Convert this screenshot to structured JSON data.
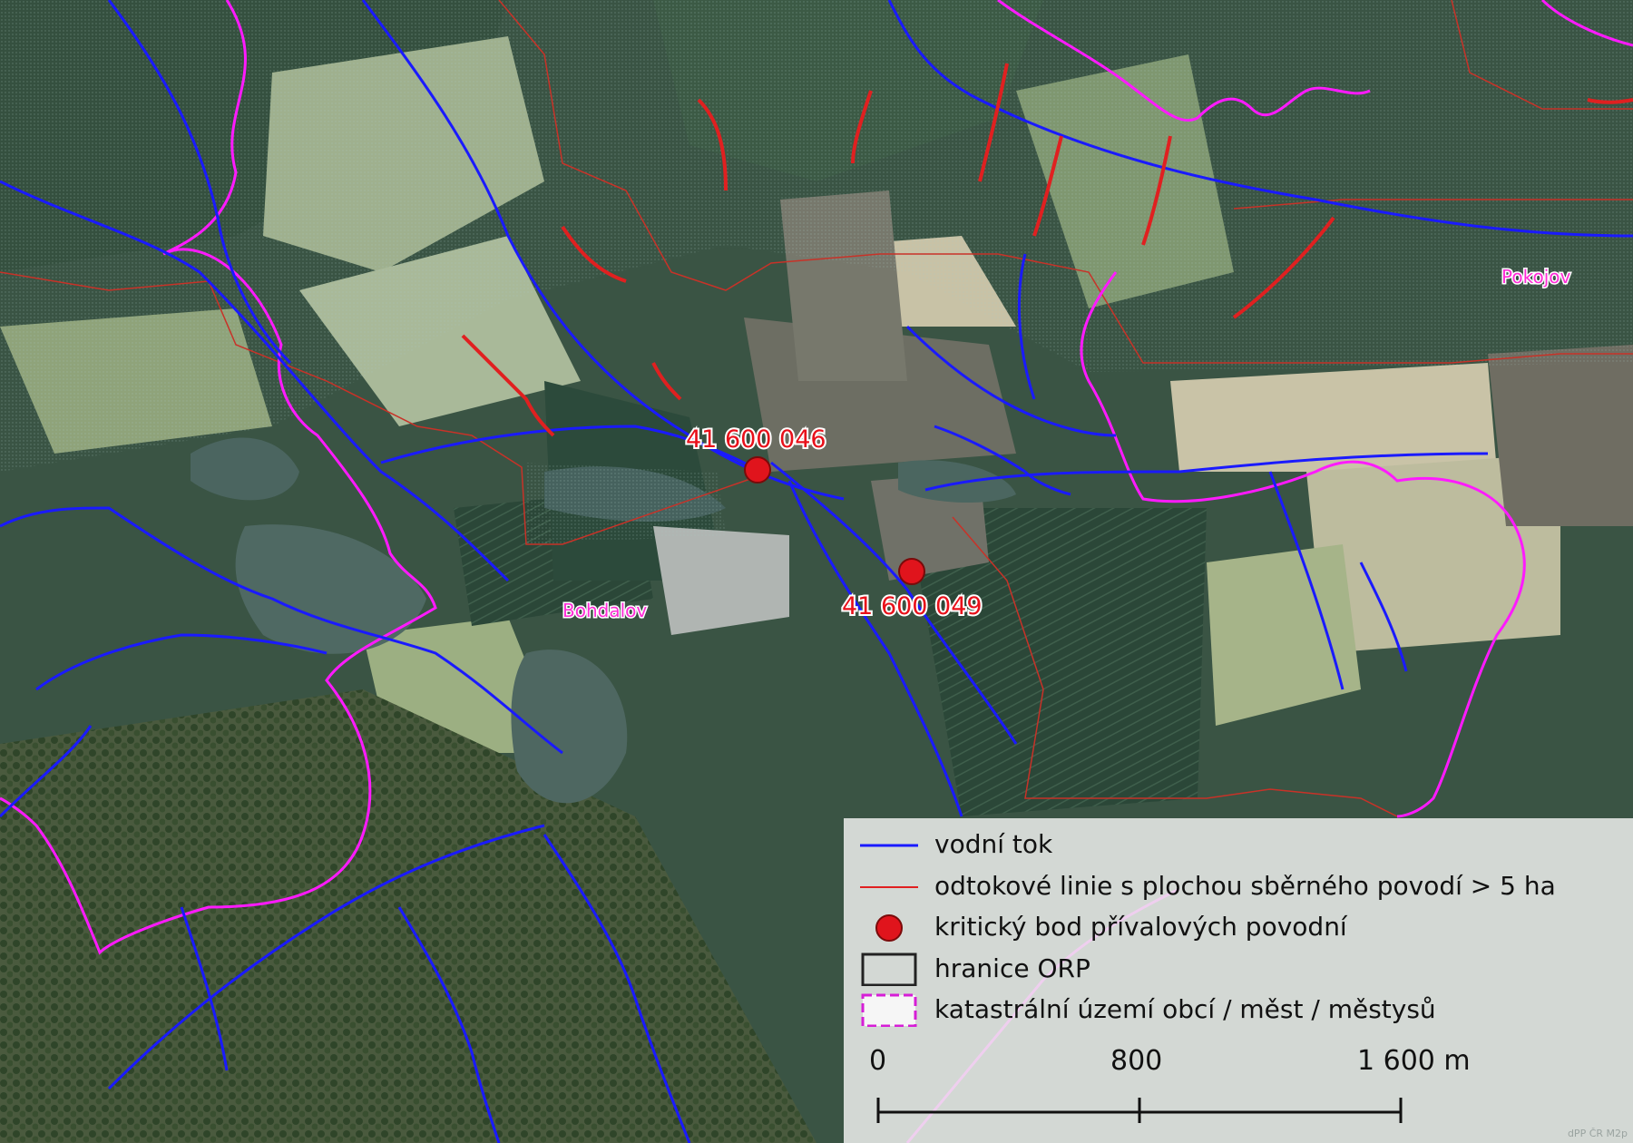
{
  "places": {
    "bohdalov": "Bohdalov",
    "pokojov": "Pokojov"
  },
  "critical_points": [
    {
      "id": "41 600 046"
    },
    {
      "id": "41 600 049"
    }
  ],
  "legend": {
    "items": [
      {
        "label": "vodní tok",
        "symbol": "line",
        "color": "#1a1aff"
      },
      {
        "label": "odtokové linie s plochou sběrného povodí > 5 ha",
        "symbol": "line",
        "color": "#e02020"
      },
      {
        "label": "kritický bod přívalových povodní",
        "symbol": "circle",
        "color": "#e0141c"
      },
      {
        "label": "hranice ORP",
        "symbol": "box",
        "color": "#222222"
      },
      {
        "label": "katastrální území obcí / měst / městysů",
        "symbol": "dashed-box",
        "color": "#d61ed6"
      }
    ]
  },
  "scale_bar": {
    "labels": [
      "0",
      "800",
      "1 600 m"
    ]
  },
  "colors": {
    "water": "#1a1aff",
    "runoff": "#e02020",
    "cadastral": "#ff1aff",
    "critical": "#e0141c",
    "orp_border": "#c83228"
  },
  "credit": "dPP ČR M2p"
}
